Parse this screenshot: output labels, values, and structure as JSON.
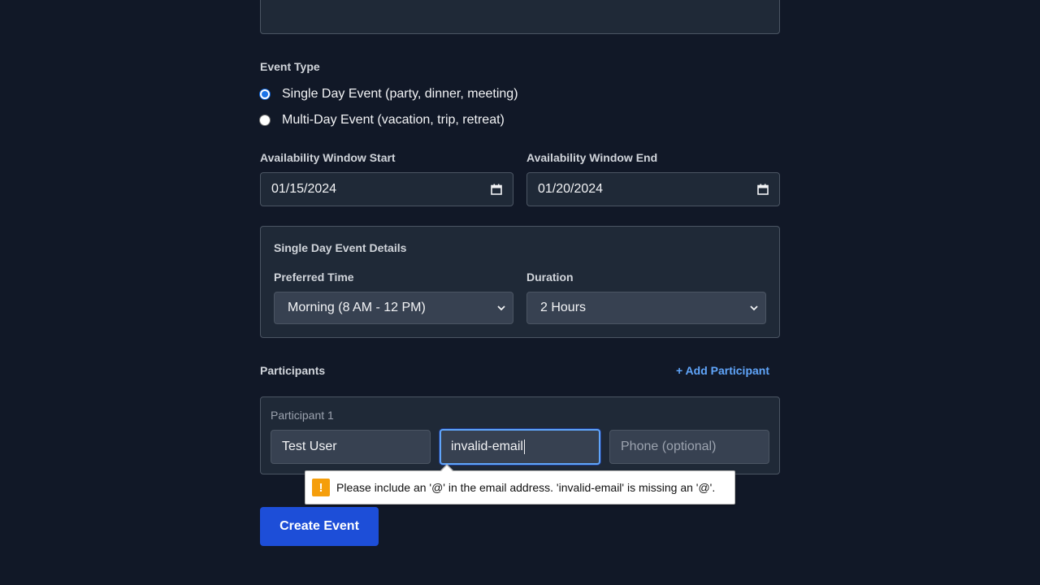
{
  "event_type": {
    "label": "Event Type",
    "options": [
      {
        "label": "Single Day Event (party, dinner, meeting)",
        "checked": true
      },
      {
        "label": "Multi-Day Event (vacation, trip, retreat)",
        "checked": false
      }
    ]
  },
  "availability": {
    "start_label": "Availability Window Start",
    "start_value": "01/15/2024",
    "end_label": "Availability Window End",
    "end_value": "01/20/2024"
  },
  "single_day": {
    "title": "Single Day Event Details",
    "preferred_time_label": "Preferred Time",
    "preferred_time_value": "Morning (8 AM - 12 PM)",
    "duration_label": "Duration",
    "duration_value": "2 Hours"
  },
  "participants": {
    "label": "Participants",
    "add_label": "+ Add Participant",
    "items": [
      {
        "title": "Participant 1",
        "name_value": "Test User",
        "email_value": "invalid-email",
        "phone_placeholder": "Phone (optional)"
      }
    ]
  },
  "validation": {
    "message": "Please include an '@' in the email address. 'invalid-email' is missing an '@'.",
    "icon": "warning-icon"
  },
  "submit_label": "Create Event",
  "colors": {
    "background": "#111827",
    "panel": "#1f2937",
    "accent": "#1d4ed8",
    "link": "#60a5fa",
    "warning": "#f59e0b"
  }
}
